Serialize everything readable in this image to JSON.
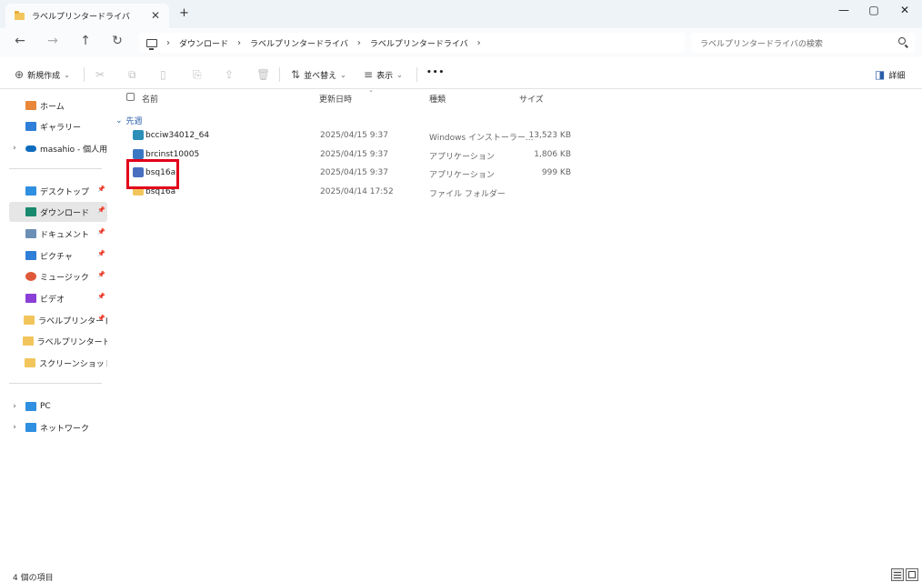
{
  "window": {
    "tab_title": "ラベルプリンタードライバ",
    "tab_close": "✕",
    "new_tab": "+",
    "minimize": "—",
    "maximize": "▢",
    "close": "✕"
  },
  "nav": {
    "back_icon": "←",
    "forward_icon": "→",
    "up_icon": "↑",
    "refresh_icon": "↻",
    "breadcrumb": [
      "ダウンロード",
      "ラベルプリンタードライバ",
      "ラベルプリンタードライバ"
    ],
    "search_placeholder": "ラベルプリンタードライバの検索"
  },
  "toolbar": {
    "new_label": "新規作成",
    "sort_label": "並べ替え",
    "view_label": "表示",
    "more_label": "•••",
    "details_label": "詳細"
  },
  "sidebar": {
    "items": [
      {
        "label": "ホーム",
        "icon": "home-icon",
        "color": "#e8873a"
      },
      {
        "label": "ギャラリー",
        "icon": "gallery-icon",
        "color": "#2f7fd8"
      },
      {
        "label": "masahio - 個人用",
        "icon": "onedrive-icon",
        "color": "#0f6cbd"
      },
      {
        "label": "デスクトップ",
        "icon": "desktop-icon",
        "color": "#2f8fe0"
      },
      {
        "label": "ダウンロード",
        "icon": "download-icon",
        "color": "#1a8a6e"
      },
      {
        "label": "ドキュメント",
        "icon": "documents-icon",
        "color": "#6c8fb5"
      },
      {
        "label": "ピクチャ",
        "icon": "pictures-icon",
        "color": "#2f7fd8"
      },
      {
        "label": "ミュージック",
        "icon": "music-icon",
        "color": "#e0583a"
      },
      {
        "label": "ビデオ",
        "icon": "video-icon",
        "color": "#8b3fd6"
      },
      {
        "label": "ラベルプリンタードラ",
        "icon": "folder-icon",
        "color": "#f2c55c"
      },
      {
        "label": "ラベルプリンタードライバ",
        "icon": "folder-icon",
        "color": "#f2c55c"
      },
      {
        "label": "スクリーンショット",
        "icon": "folder-icon",
        "color": "#f2c55c"
      },
      {
        "label": "PC",
        "icon": "pc-icon",
        "color": "#2f8fe0"
      },
      {
        "label": "ネットワーク",
        "icon": "network-icon",
        "color": "#2f8fe0"
      }
    ]
  },
  "list": {
    "columns": {
      "name": "名前",
      "modified": "更新日時",
      "type": "種類",
      "size": "サイズ"
    },
    "group": "先週",
    "files": [
      {
        "name": "bcciw34012_64",
        "modified": "2025/04/15 9:37",
        "type": "Windows インストーラー...",
        "size": "13,523 KB",
        "icon": "installer-icon",
        "color": "#2c8fb8"
      },
      {
        "name": "brcinst10005",
        "modified": "2025/04/15 9:37",
        "type": "アプリケーション",
        "size": "1,806 KB",
        "icon": "application-icon",
        "color": "#3b78c4"
      },
      {
        "name": "bsq16a",
        "modified": "2025/04/15 9:37",
        "type": "アプリケーション",
        "size": "999 KB",
        "icon": "application-icon",
        "color": "#4a6fc0"
      },
      {
        "name": "bsq16a",
        "modified": "2025/04/14 17:52",
        "type": "ファイル フォルダー",
        "size": "",
        "icon": "folder-icon",
        "color": "#f2c55c"
      }
    ]
  },
  "status": {
    "item_count": "4 個の項目"
  }
}
